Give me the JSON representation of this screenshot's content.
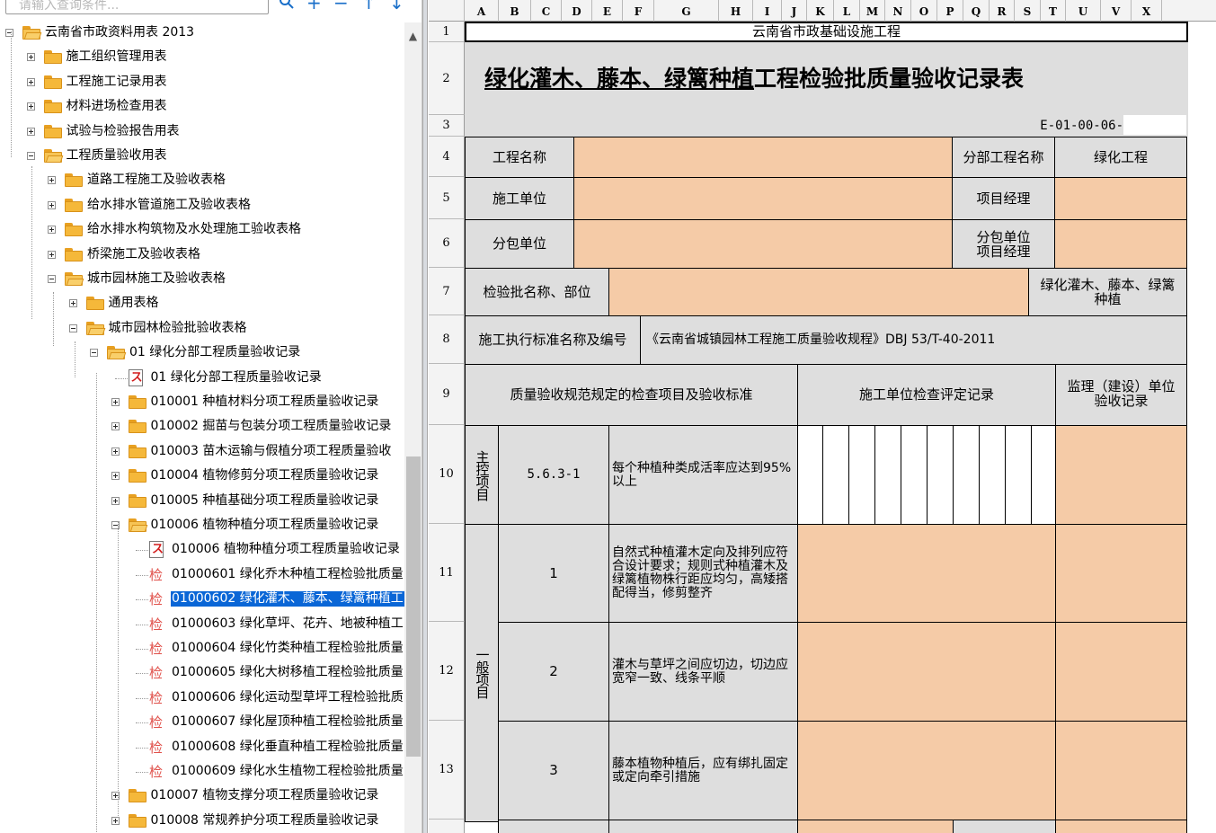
{
  "search": {
    "placeholder": "请输入查询条件..."
  },
  "toolbar": {
    "search_icon": "search-icon",
    "add_icon": "plus-icon",
    "remove_icon": "minus-icon",
    "up_icon": "arrow-up-icon",
    "down_icon": "arrow-down-icon"
  },
  "tree": [
    {
      "label": "云南省市政资料用表 2013"
    },
    {
      "label": "施工组织管理用表"
    },
    {
      "label": "工程施工记录用表"
    },
    {
      "label": "材料进场检查用表"
    },
    {
      "label": "试验与检验报告用表"
    },
    {
      "label": "工程质量验收用表"
    },
    {
      "label": "道路工程施工及验收表格"
    },
    {
      "label": "给水排水管道施工及验收表格"
    },
    {
      "label": "给水排水构筑物及水处理施工验收表格"
    },
    {
      "label": "桥梁施工及验收表格"
    },
    {
      "label": "城市园林施工及验收表格"
    },
    {
      "label": "通用表格"
    },
    {
      "label": "城市园林检验批验收表格"
    },
    {
      "label": "01 绿化分部工程质量验收记录"
    },
    {
      "label": "01 绿化分部工程质量验收记录"
    },
    {
      "label": "010001 种植材料分项工程质量验收记录"
    },
    {
      "label": "010002 掘苗与包装分项工程质量验收记录"
    },
    {
      "label": "010003 苗木运输与假植分项工程质量验收"
    },
    {
      "label": "010004 植物修剪分项工程质量验收记录"
    },
    {
      "label": "010005 种植基础分项工程质量验收记录"
    },
    {
      "label": "010006 植物种植分项工程质量验收记录"
    },
    {
      "label": "010006 植物种植分项工程质量验收记录"
    },
    {
      "label": "01000601 绿化乔木种植工程检验批质量"
    },
    {
      "label": "01000602 绿化灌木、藤本、绿篱种植工"
    },
    {
      "label": "01000603 绿化草坪、花卉、地被种植工"
    },
    {
      "label": "01000604 绿化竹类种植工程检验批质量"
    },
    {
      "label": "01000605 绿化大树移植工程检验批质量"
    },
    {
      "label": "01000606 绿化运动型草坪工程检验批质"
    },
    {
      "label": "01000607 绿化屋顶种植工程检验批质量"
    },
    {
      "label": "01000608 绿化垂直种植工程检验批质量"
    },
    {
      "label": "01000609 绿化水生植物工程检验批质量"
    },
    {
      "label": "010007 植物支撑分项工程质量验收记录"
    },
    {
      "label": "010008 常规养护分项工程质量验收记录"
    }
  ],
  "jian_glyph": "检",
  "pdf_glyph": "ス",
  "columns": [
    "A",
    "B",
    "C",
    "D",
    "E",
    "F",
    "G",
    "H",
    "I",
    "J",
    "K",
    "L",
    "M",
    "N",
    "O",
    "P",
    "Q",
    "R",
    "S",
    "T",
    "U",
    "V",
    "X"
  ],
  "rows": [
    "1",
    "2",
    "3",
    "4",
    "5",
    "6",
    "7",
    "8",
    "9",
    "10",
    "11",
    "12",
    "13"
  ],
  "form": {
    "org_title": "云南省市政基础设施工程",
    "title_underlined": "绿化灌木、藤本、绿篱种植",
    "title_rest": " 工程检验批质量验收记录表",
    "code": "E-01-00-06-",
    "project_name_label": "工程名称",
    "division_label": "分部工程名称",
    "division_value": "绿化工程",
    "contractor_label": "施工单位",
    "manager_label": "项目经理",
    "sub_label": "分包单位",
    "sub_manager_label": "分包单位\n项目经理",
    "batch_label": "检验批名称、部位",
    "batch_value": "绿化灌木、藤本、绿篱\n种植",
    "standard_label": "施工执行标准名称及编号",
    "standard_value": "《云南省城镇园林工程施工质量验收规程》DBJ 53/T-40-2011",
    "header_items": "质量验收规范规定的检查项目及验收标准",
    "header_contractor": "施工单位检查评定记录",
    "header_supervisor": "监理（建设）单位\n验收记录",
    "main_items_label": "主控项目",
    "general_items_label": "一般项目",
    "item1_code": "5.6.3-1",
    "item1_text": "每个种植种类成活率应达到95%以上",
    "item2_code": "1",
    "item2_text": "自然式种植灌木定向及排列应符合设计要求；规则式种植灌木及绿篱植物株行距应均匀，高矮搭配得当，修剪整齐",
    "item3_code": "2",
    "item3_text": "灌木与草坪之间应切边，切边应宽窄一致、线条平顺",
    "item4_code": "3",
    "item4_text": "藤本植物种植后，应有绑扎固定或定向牵引措施"
  }
}
